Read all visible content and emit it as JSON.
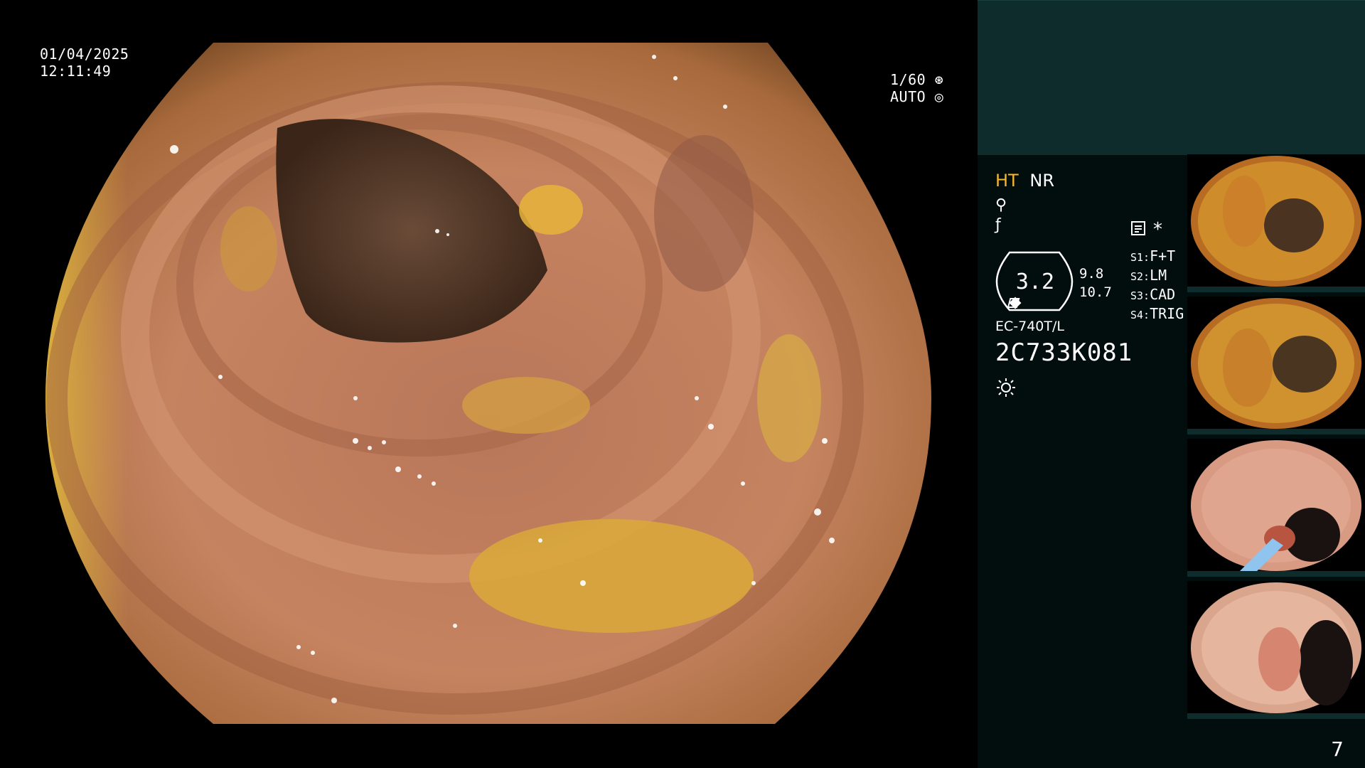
{
  "overlay": {
    "date": "01/04/2025",
    "time": "12:11:49",
    "shutter": "1/60",
    "mode": "AUTO"
  },
  "panel": {
    "mode_ht": "HT",
    "mode_nr": "NR",
    "zoom_main": "3.2",
    "zoom_value_1": "9.8",
    "zoom_value_2": "10.7",
    "switches": [
      {
        "key": "S1:",
        "value": "F+T"
      },
      {
        "key": "S2:",
        "value": "LM"
      },
      {
        "key": "S3:",
        "value": "CAD"
      },
      {
        "key": "S4:",
        "value": "TRIG"
      }
    ],
    "scope_model": "EC-740T/L",
    "scope_serial": "2C733K081",
    "page_number": "7"
  },
  "colors": {
    "panel_bg": "#020e0d",
    "panel_top": "#0f2c2c",
    "accent_ht": "#f7b72a"
  },
  "icons": [
    "camera-shutter-icon",
    "auto-exposure-icon",
    "structure-enhance-icon",
    "color-enhance-icon",
    "memo-icon",
    "asterisk-icon",
    "light-source-icon"
  ]
}
